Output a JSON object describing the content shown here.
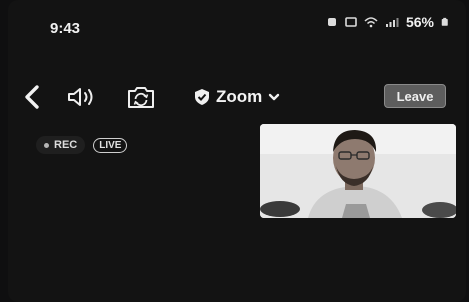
{
  "status_bar": {
    "time": "9:43",
    "battery": "56%"
  },
  "toolbar": {
    "back_icon": "chevron-left-icon",
    "speaker_icon": "speaker-icon",
    "camera_switch_icon": "camera-switch-icon",
    "meeting_title": "Zoom",
    "shield_icon": "shield-check-icon",
    "leave_label": "Leave"
  },
  "recording": {
    "rec_label": "REC",
    "live_label": "LIVE"
  },
  "colors": {
    "background": "#131313",
    "leave_button": "#5d5d5d"
  }
}
